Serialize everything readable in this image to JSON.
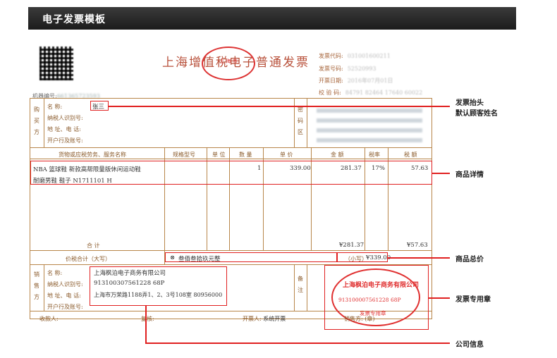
{
  "page": {
    "title": "电子发票模板"
  },
  "invoice": {
    "title": "上海增值税电子普通发票",
    "stamp_small": "上 海 市",
    "meta_labels": [
      "发票代码:",
      "发票号码:",
      "开票日期:",
      "校 验 码:"
    ],
    "meta_values": [
      "031001600211",
      "52520993",
      "2016年07月01日",
      "84791 82464 17640 60022"
    ],
    "machine_label": "机器编号:",
    "machine_value": "661365723593",
    "buyer": {
      "side_label": "购买方",
      "name_label": "名      称:",
      "name_value": "张三",
      "tax_label": "纳税人识别号:",
      "addr_label": "地  址、电  话:",
      "bank_label": "开户行及账号:"
    },
    "pwd_label": "密码区",
    "columns": [
      "货物或应税劳务、服务名称",
      "规格型号",
      "单 位",
      "数 量",
      "单 价",
      "金 额",
      "税率",
      "税 额"
    ],
    "item": {
      "name_line1": "NBA 篮球鞋 新款高帮限量版休闲运动鞋",
      "name_line2": "耐磨男鞋 鞋子 N1711101 H",
      "qty": "1",
      "price": "339.00",
      "amount": "281.37",
      "rate": "17%",
      "tax": "57.63"
    },
    "total_label": "合      计",
    "total_amount": "¥281.37",
    "total_tax": "¥57.63",
    "grand_label": "价税合计（大写）",
    "grand_words": "叁佰叁拾玖元整",
    "grand_small_label": "（小写）",
    "grand_small_value": "¥339.00",
    "seller": {
      "side_label": "销售方",
      "name_label": "名      称:",
      "name_value": "上海枫泊电子商务有限公司",
      "tax_label": "纳税人识别号:",
      "tax_value": "913100307561228 68P",
      "addr_label": "地  址、电  话:",
      "addr_value": "上海市万荣路1188弄1、2、3号108室 80956000",
      "bank_label": "开户行及账号:"
    },
    "remark_label": "备注",
    "stamp_big": {
      "company": "上海枫泊电子商务有限公司",
      "number": "913100007561228 68P",
      "type": "发票专用章"
    },
    "footer": {
      "payee": "收款人:",
      "reviewer": "复核:",
      "issuer_label": "开票人:",
      "issuer_value": "系统开票",
      "seller_label": "销售方:",
      "seller_value": "(章)"
    }
  },
  "annotations": {
    "buyer_title": "发票抬头",
    "buyer_title_sub": "默认顾客姓名",
    "item_detail": "商品详情",
    "total_price": "商品总价",
    "stamp": "发票专用章",
    "company_info": "公司信息"
  },
  "colors": {
    "accent": "#e02020",
    "form_line": "#b8864a",
    "header_bg": "#2a2a2a"
  }
}
